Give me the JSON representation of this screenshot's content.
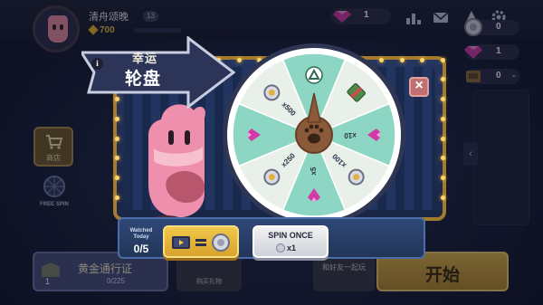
{
  "player": {
    "name": "清舟颂晚",
    "level": "13",
    "gold": "700"
  },
  "currency": {
    "gems": "1"
  },
  "side_resources": [
    {
      "icon": "coin-icon",
      "value": "0"
    },
    {
      "icon": "gem-icon",
      "value": "1"
    },
    {
      "icon": "ticket-icon",
      "value": "0"
    }
  ],
  "left_menu": {
    "shop_label": "商店",
    "free_spin_label": "FREE SPIN"
  },
  "banner": {
    "line1": "幸运",
    "line2": "轮盘"
  },
  "wheel": {
    "segments": [
      {
        "label": "",
        "icon": "mystery-box-icon",
        "color": "#8ed6c4"
      },
      {
        "label": "",
        "icon": "treasure-box-icon",
        "color": "#e9f0ea"
      },
      {
        "label": "x10",
        "icon": "gem-icon",
        "color": "#8ed6c4"
      },
      {
        "label": "x100",
        "icon": "coin-icon",
        "color": "#e9f0ea"
      },
      {
        "label": "x5",
        "icon": "gem-icon",
        "color": "#8ed6c4"
      },
      {
        "label": "x250",
        "icon": "coin-icon",
        "color": "#e9f0ea"
      },
      {
        "label": "",
        "icon": "gem-icon",
        "color": "#8ed6c4"
      },
      {
        "label": "x500",
        "icon": "coin-icon",
        "color": "#e9f0ea"
      }
    ]
  },
  "watch": {
    "label_line1": "Watched",
    "label_line2": "Today",
    "count": "0/5"
  },
  "spin": {
    "label": "SPIN ONCE",
    "cost": "x1"
  },
  "bottom": {
    "ranking_title": "黄金通行证",
    "ranking_level": "1",
    "ranking_progress": "0/225",
    "gift_label": "购买礼物",
    "play_together_label": "和好友一起玩",
    "start_label": "开始"
  }
}
